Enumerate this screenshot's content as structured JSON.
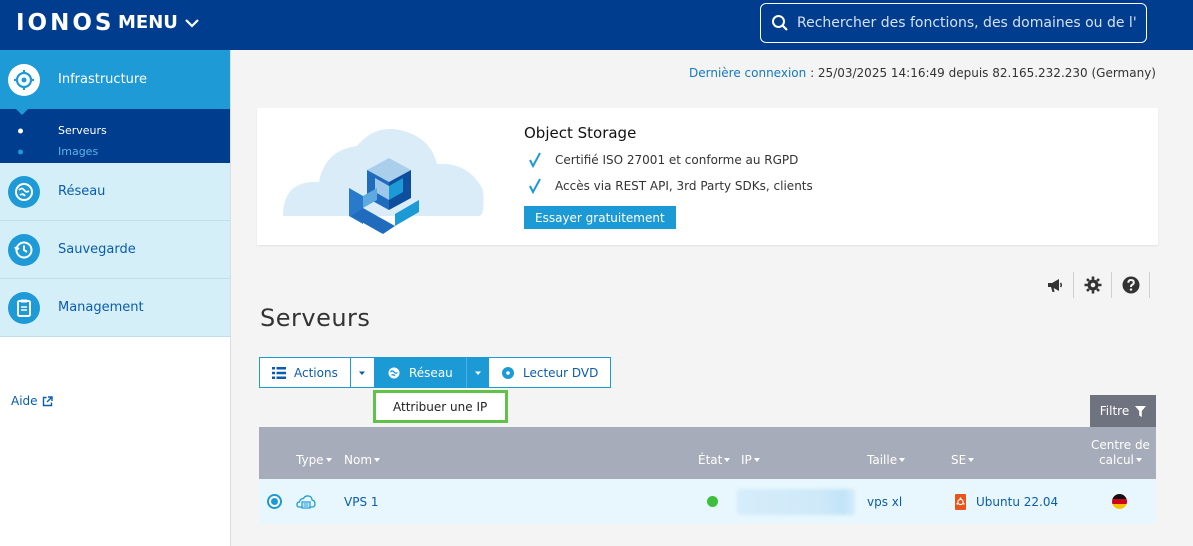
{
  "header": {
    "logo": "IONOS",
    "menu_label": "MENU",
    "search_placeholder": "Rechercher des fonctions, des domaines ou de l'..."
  },
  "sidebar": {
    "main_item": "Infrastructure",
    "sub_items": [
      {
        "label": "Serveurs",
        "active": true
      },
      {
        "label": "Images",
        "active": false
      }
    ],
    "sections": [
      {
        "label": "Réseau",
        "icon": "network-icon"
      },
      {
        "label": "Sauvegarde",
        "icon": "backup-icon"
      },
      {
        "label": "Management",
        "icon": "clipboard-icon"
      }
    ],
    "help_label": "Aide"
  },
  "last_login": {
    "label": "Dernière connexion",
    "value": " : 25/03/2025 14:16:49 depuis 82.165.232.230 (Germany)"
  },
  "promo": {
    "title": "Object Storage",
    "features": [
      "Certifié ISO 27001 et conforme au RGPD",
      "Accès via REST API, 3rd Party SDKs, clients"
    ],
    "button_label": "Essayer gratuitement"
  },
  "page_title": "Serveurs",
  "toolbar": {
    "actions_label": "Actions",
    "network_label": "Réseau",
    "dvd_label": "Lecteur DVD",
    "dropdown_item": "Attribuer une IP",
    "filter_label": "Filtre"
  },
  "table": {
    "columns": {
      "type": "Type",
      "name": "Nom",
      "state": "État",
      "ip": "IP",
      "size": "Taille",
      "os": "SE",
      "datacenter_line1": "Centre de",
      "datacenter_line2": "calcul"
    },
    "rows": [
      {
        "name": "VPS 1",
        "status": "running",
        "ip": "",
        "size": "vps xl",
        "os": "Ubuntu 22.04",
        "datacenter_flag": "DE"
      }
    ]
  },
  "colors": {
    "brand_dark": "#003d8f",
    "accent": "#1c9ad6",
    "highlight": "#61c24a",
    "status_ok": "#3dbf3d"
  }
}
